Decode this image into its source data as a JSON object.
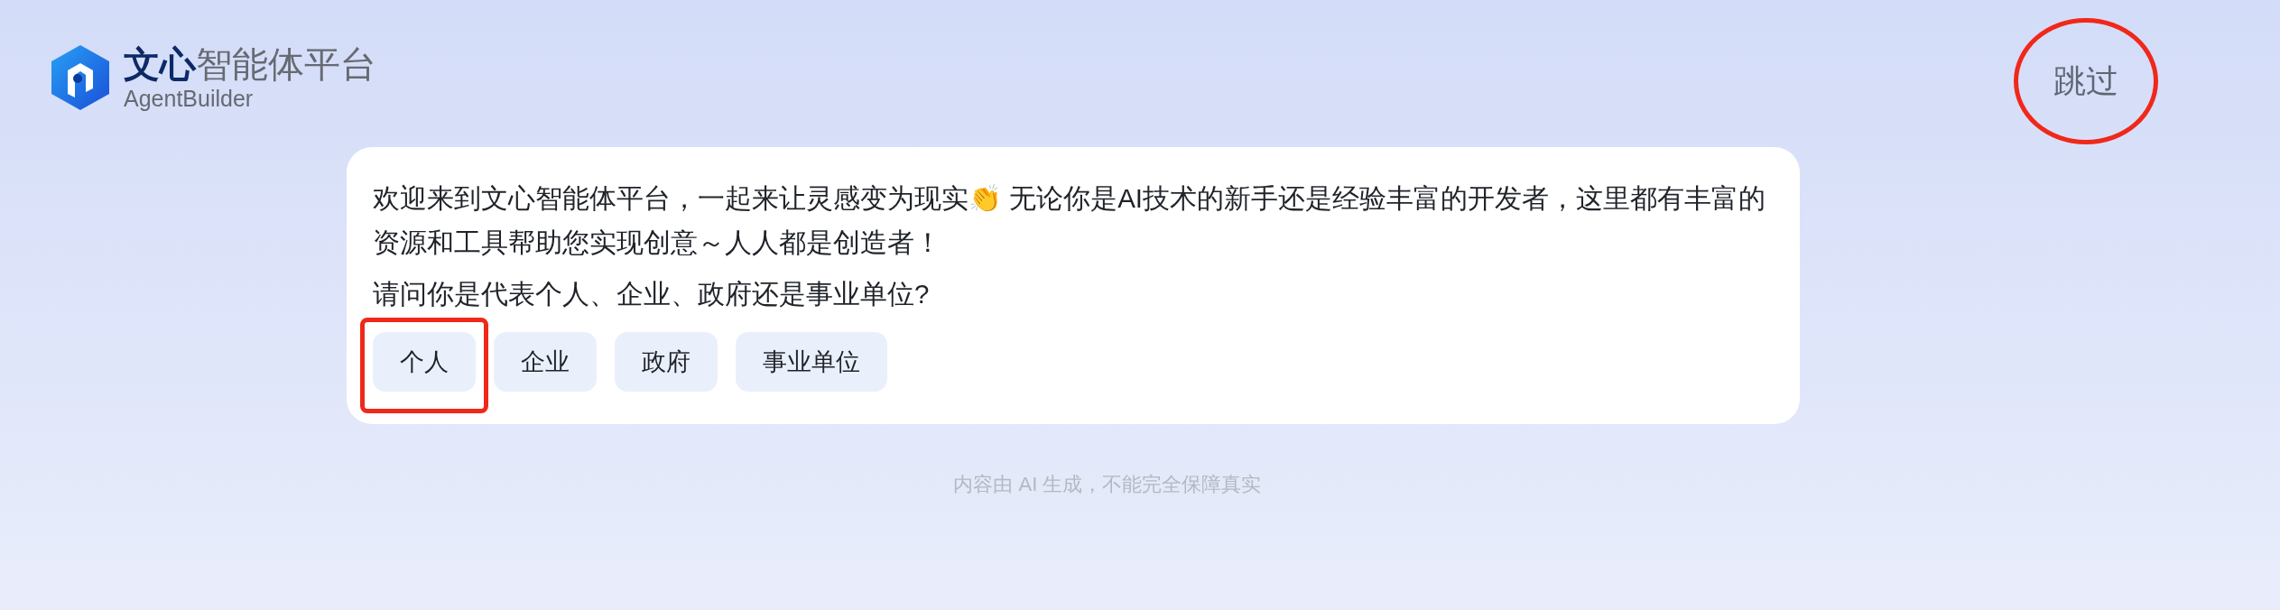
{
  "logo": {
    "brand": "文心",
    "product": "智能体平台",
    "subtitle": "AgentBuilder"
  },
  "skip_button": {
    "label": "跳过",
    "highlighted": true
  },
  "message": {
    "paragraphs": [
      "欢迎来到文心智能体平台，一起来让灵感变为现实👏 无论你是AI技术的新手还是经验丰富的开发者，这里都有丰富的资源和工具帮助您实现创意～人人都是创造者！",
      "请问你是代表个人、企业、政府还是事业单位?"
    ],
    "options": [
      {
        "label": "个人",
        "highlighted": true
      },
      {
        "label": "企业",
        "highlighted": false
      },
      {
        "label": "政府",
        "highlighted": false
      },
      {
        "label": "事业单位",
        "highlighted": false
      }
    ]
  },
  "disclaimer": "内容由 AI 生成，不能完全保障真实"
}
